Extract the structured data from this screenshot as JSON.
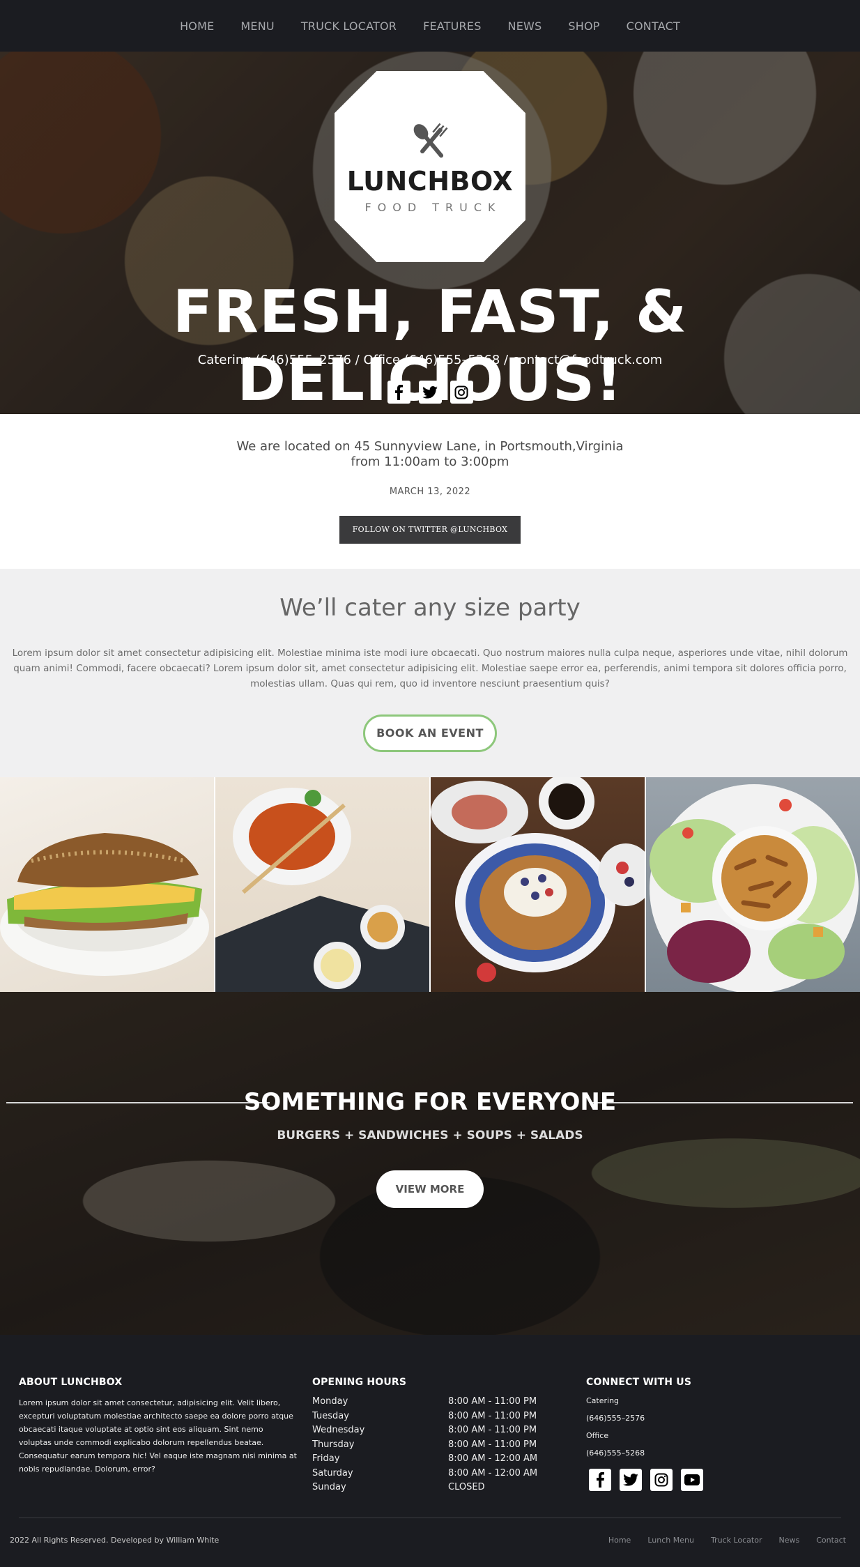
{
  "nav": {
    "items": [
      "HOME",
      "MENU",
      "TRUCK LOCATOR",
      "FEATURES",
      "NEWS",
      "SHOP",
      "CONTACT"
    ]
  },
  "hero": {
    "brand": "LUNCHBOX",
    "tagline": "FOOD TRUCK",
    "title": "FRESH, FAST, & DELICIOUS!",
    "contact": "Catering (646)555–2576 / Office (646)555–5268 / contact@foodtruck.com",
    "social_icons": [
      "facebook-icon",
      "twitter-icon",
      "instagram-icon"
    ]
  },
  "location": {
    "line1": "We are located on 45 Sunnyview Lane, in Portsmouth,Virginia",
    "line2": "from 11:00am to 3:00pm",
    "date": "MARCH 13, 2022",
    "twitter_button": "FOLLOW ON TWITTER @LUNCHBOX"
  },
  "cater": {
    "title": "We’ll cater any size party",
    "body": "Lorem ipsum dolor sit amet consectetur adipisicing elit. Molestiae minima iste modi iure obcaecati. Quo nostrum maiores nulla culpa neque, asperiores unde vitae, nihil dolorum quam animi! Commodi, facere obcaecati? Lorem ipsum dolor sit, amet consectetur adipisicing elit. Molestiae saepe error ea, perferendis, animi tempora sit dolores officia porro, molestias ullam. Quas qui rem, quo id inventore nesciunt praesentium quis?",
    "button": "BOOK AN EVENT"
  },
  "gallery": [
    "sandwich",
    "tomato-soup",
    "waffle",
    "chicken-salad"
  ],
  "everyone": {
    "title": "SOMETHING FOR EVERYONE",
    "subtitle": "BURGERS + SANDWICHES + SOUPS + SALADS",
    "button": "VIEW MORE"
  },
  "footer": {
    "about": {
      "heading": "ABOUT LUNCHBOX",
      "text": "Lorem ipsum dolor sit amet consectetur, adipisicing elit. Velit libero, excepturi voluptatum molestiae architecto saepe ea dolore porro atque obcaecati itaque voluptate at optio sint eos aliquam. Sint nemo voluptas unde commodi explicabo dolorum repellendus beatae. Consequatur earum tempora hic! Vel eaque iste magnam nisi minima at nobis repudiandae. Dolorum, error?"
    },
    "hours": {
      "heading": "OPENING HOURS",
      "rows": [
        {
          "day": "Monday",
          "time": "8:00 AM - 11:00 PM"
        },
        {
          "day": "Tuesday",
          "time": "8:00 AM - 11:00 PM"
        },
        {
          "day": "Wednesday",
          "time": "8:00 AM - 11:00 PM"
        },
        {
          "day": "Thursday",
          "time": "8:00 AM - 11:00 PM"
        },
        {
          "day": "Friday",
          "time": "8:00 AM - 12:00 AM"
        },
        {
          "day": "Saturday",
          "time": "8:00 AM - 12:00 AM"
        },
        {
          "day": "Sunday",
          "time": "CLOSED"
        }
      ]
    },
    "connect": {
      "heading": "CONNECT WITH US",
      "catering_label": "Catering",
      "catering_phone": "(646)555–2576",
      "office_label": "Office",
      "office_phone": "(646)555–5268",
      "social_icons": [
        "facebook-icon",
        "twitter-icon",
        "instagram-icon",
        "youtube-icon"
      ]
    },
    "copyright": "2022 All Rights Reserved. Developed by William White",
    "links": [
      "Home",
      "Lunch Menu",
      "Truck Locator",
      "News",
      "Contact"
    ]
  },
  "colors": {
    "nav_bg": "#1b1c21",
    "button_dark": "#3a3a3c",
    "book_border": "#8dc77b",
    "section_gray": "#f0f0f1"
  }
}
